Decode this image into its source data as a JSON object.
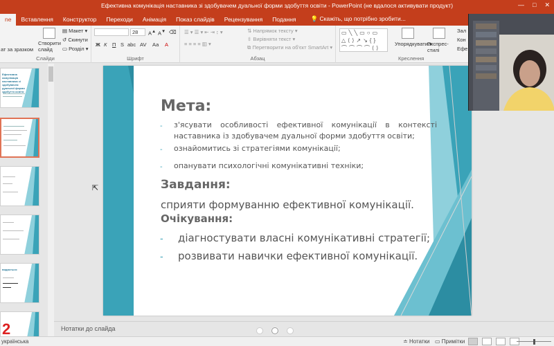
{
  "window": {
    "title": "Ефективна комунікація наставника зі здобувачем дуальної форми здобуття освіти - PowerPoint (не вдалося активувати продукт)",
    "controls": [
      "—",
      "□",
      "✕"
    ]
  },
  "ribbon_tabs": [
    {
      "label": "ne",
      "active": true
    },
    {
      "label": "Вставлення",
      "active": false
    },
    {
      "label": "Конструктор",
      "active": false
    },
    {
      "label": "Переходи",
      "active": false
    },
    {
      "label": "Анімація",
      "active": false
    },
    {
      "label": "Показ слайдів",
      "active": false
    },
    {
      "label": "Рецензування",
      "active": false
    },
    {
      "label": "Подання",
      "active": false
    }
  ],
  "tell_me": "Скажіть, що потрібно зробити...",
  "ribbon": {
    "slides_group": {
      "new_slide": "Створити слайд",
      "layout": "Макет",
      "reset": "Скинути",
      "section": "Розділ",
      "format_painter": "ат за зразком",
      "label": "Слайди"
    },
    "font_group": {
      "font_size": "28",
      "bold": "Ж",
      "italic": "К",
      "underline": "П",
      "strikethrough": "S",
      "spacing": "abc",
      "change_case": "AV",
      "aa": "Аа",
      "label": "Шрифт"
    },
    "paragraph_group": {
      "text_direction": "Напрямок тексту",
      "align_text": "Вирівняти текст",
      "smartart": "Перетворити на об'єкт SmartArt",
      "label": "Абзац"
    },
    "drawing_group": {
      "arrange": "Упорядкувати",
      "quick_styles": "Експрес-стилі",
      "fill": "Зал",
      "outline": "Кон",
      "effects": "Ефе",
      "label": "Креслення"
    }
  },
  "thumbnails": [
    {
      "index": 1,
      "selected": false,
      "kind": "title",
      "text": "Ефективна комунікація наставника зі здобувачем дуальної форми здобуття освіти"
    },
    {
      "index": 2,
      "selected": true,
      "kind": "text",
      "text": ""
    },
    {
      "index": 3,
      "selected": false,
      "kind": "text",
      "text": ""
    },
    {
      "index": 4,
      "selected": false,
      "kind": "text",
      "text": ""
    },
    {
      "index": 5,
      "selected": false,
      "kind": "stats",
      "text": "видається:"
    },
    {
      "index": 6,
      "selected": false,
      "kind": "number",
      "text": "2"
    }
  ],
  "slide": {
    "heading_goal": "Мета:",
    "goal_items": [
      "з'ясувати особливості ефективної комунікації в контексті наставника із здобувачем дуальної форми здобуття освіти;",
      "ознайомитись зі стратегіями комунікації;",
      "опанувати психологічні комунікативні техніки;"
    ],
    "heading_tasks": "Завдання:",
    "tasks_text": "сприяти формуванню ефективної комунікації.",
    "heading_expectations": "Очікування:",
    "expectation_items": [
      "діагностувати власні комунікативні стратегії;",
      "розвивати навички ефективної комунікації."
    ],
    "bullet_marker": "-"
  },
  "notes": {
    "placeholder": "Нотатки до слайда"
  },
  "status": {
    "language": "українська",
    "notes_button": "Нотатки",
    "comments_button": "Примітки"
  },
  "colors": {
    "accent": "#c43e1c",
    "teal": "#3aa3b8",
    "teal_light": "#8fd0dc"
  }
}
